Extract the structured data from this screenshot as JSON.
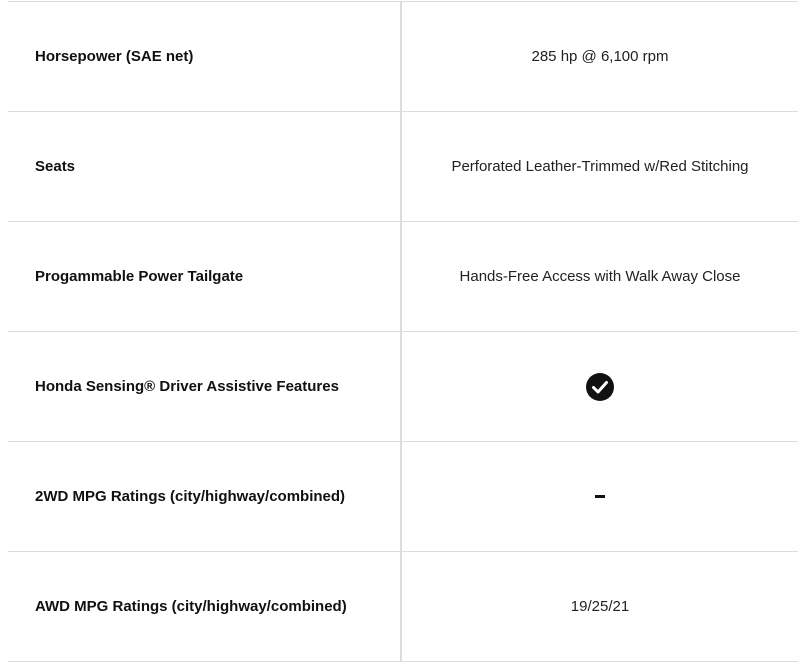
{
  "rows": [
    {
      "label": "Horsepower (SAE net)",
      "value": "285 hp @ 6,100 rpm"
    },
    {
      "label": "Seats",
      "value": "Perforated Leather-Trimmed w/Red Stitching"
    },
    {
      "label": "Progammable Power Tailgate",
      "value": "Hands-Free Access with Walk Away Close"
    },
    {
      "label": "Honda Sensing® Driver Assistive Features",
      "value_icon": "check-circle-icon"
    },
    {
      "label": "2WD MPG Ratings (city/highway/combined)",
      "value_icon": "dash-icon"
    },
    {
      "label": "AWD MPG Ratings (city/highway/combined)",
      "value": "19/25/21"
    }
  ],
  "colors": {
    "border": "#dcdcdc",
    "text": "#111111"
  }
}
